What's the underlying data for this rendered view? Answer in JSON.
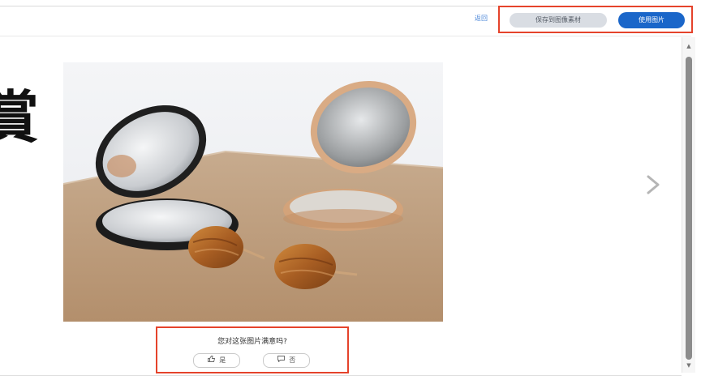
{
  "topbar": {
    "back_label": "返回",
    "save_label": "保存到图像素材",
    "select_label": "使用图片"
  },
  "left_glyph": "賞",
  "photo": {
    "alt": "photo"
  },
  "feedback": {
    "question": "您对这张图片满意吗?",
    "yes_label": "是",
    "no_label": "否"
  },
  "icons": {
    "like": "thumbs-up-icon",
    "dislike": "comment-icon",
    "next": "chevron-right-icon"
  },
  "colors": {
    "accent": "#1a66c9",
    "highlight_border": "#e5432b",
    "secondary_button": "#d9dde3"
  }
}
